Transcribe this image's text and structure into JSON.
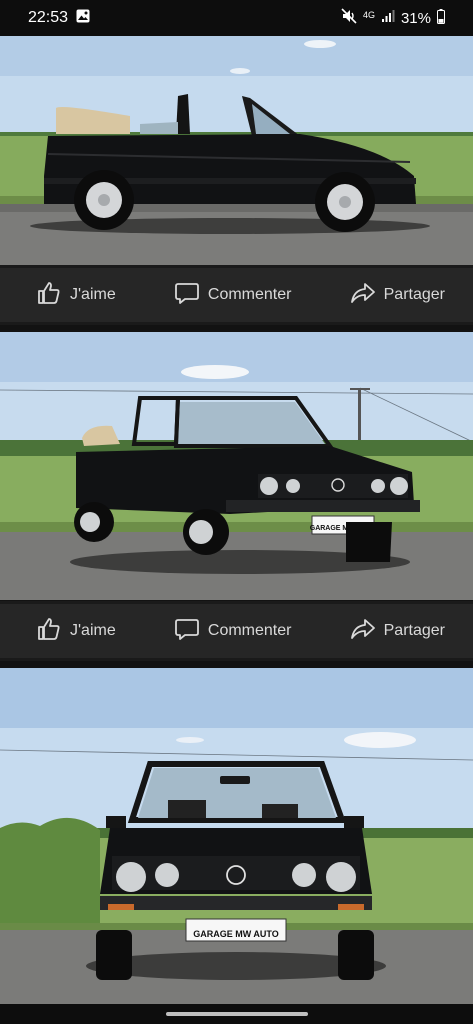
{
  "status_bar": {
    "time": "22:53",
    "network": "4G",
    "battery": "31%"
  },
  "posts": [
    {
      "plate": "",
      "actions": {
        "like": "J'aime",
        "comment": "Commenter",
        "share": "Partager"
      }
    },
    {
      "plate": "GARAGE MW AUTO",
      "actions": {
        "like": "J'aime",
        "comment": "Commenter",
        "share": "Partager"
      }
    },
    {
      "plate": "GARAGE MW AUTO"
    }
  ],
  "colors": {
    "background": "#121212",
    "action_bar": "#262626",
    "sky": "#bcd3ea",
    "grass": "#7ea35a",
    "asphalt": "#7a7a78",
    "car_body": "#111214"
  },
  "icons": {
    "gallery": "gallery-icon",
    "mute": "mute-icon",
    "signal": "signal-icon",
    "battery": "battery-icon",
    "like": "thumbs-up-icon",
    "comment": "comment-bubble-icon",
    "share": "share-arrow-icon"
  }
}
